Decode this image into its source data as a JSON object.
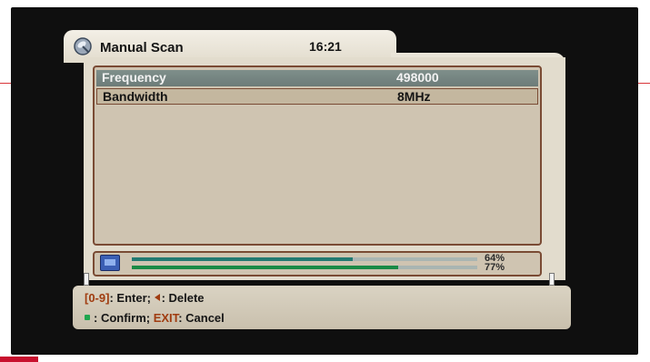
{
  "header": {
    "title": "Manual Scan",
    "time": "16:21"
  },
  "settings": [
    {
      "label": "Frequency",
      "value": "498000"
    },
    {
      "label": "Bandwidth",
      "value": "8MHz"
    }
  ],
  "signal": {
    "strength_percent": 64,
    "strength_label": "64%",
    "quality_percent": 77,
    "quality_label": "77%"
  },
  "help": {
    "line1_key": "[0-9]",
    "line1_enter": ": Enter; ",
    "line1_delete": ": Delete",
    "line2_confirm": ": Confirm; ",
    "line2_exit_key": "EXIT",
    "line2_cancel": ": Cancel"
  },
  "colors": {
    "strength_bar": "#227a72",
    "quality_bar": "#1a8a45",
    "accent_key": "#a03c10"
  }
}
